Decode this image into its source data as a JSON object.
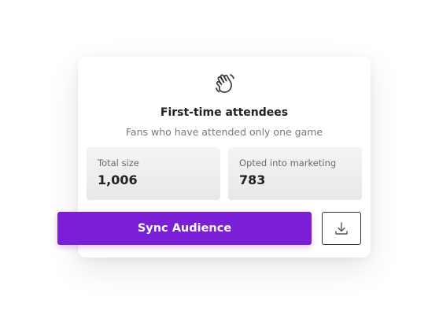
{
  "segment": {
    "icon": "waving-hand-icon",
    "title": "First-time attendees",
    "description": "Fans who have attended only one game"
  },
  "stats": [
    {
      "label": "Total size",
      "value": "1,006"
    },
    {
      "label": "Opted into marketing",
      "value": "783"
    }
  ],
  "actions": {
    "sync_label": "Sync Audience",
    "download_icon": "download-icon"
  },
  "colors": {
    "accent": "#7b1fd6",
    "card_background": "#ffffff",
    "stat_background": "#eeeeee",
    "title_text": "#222222",
    "muted_text": "#7a7a7a"
  }
}
